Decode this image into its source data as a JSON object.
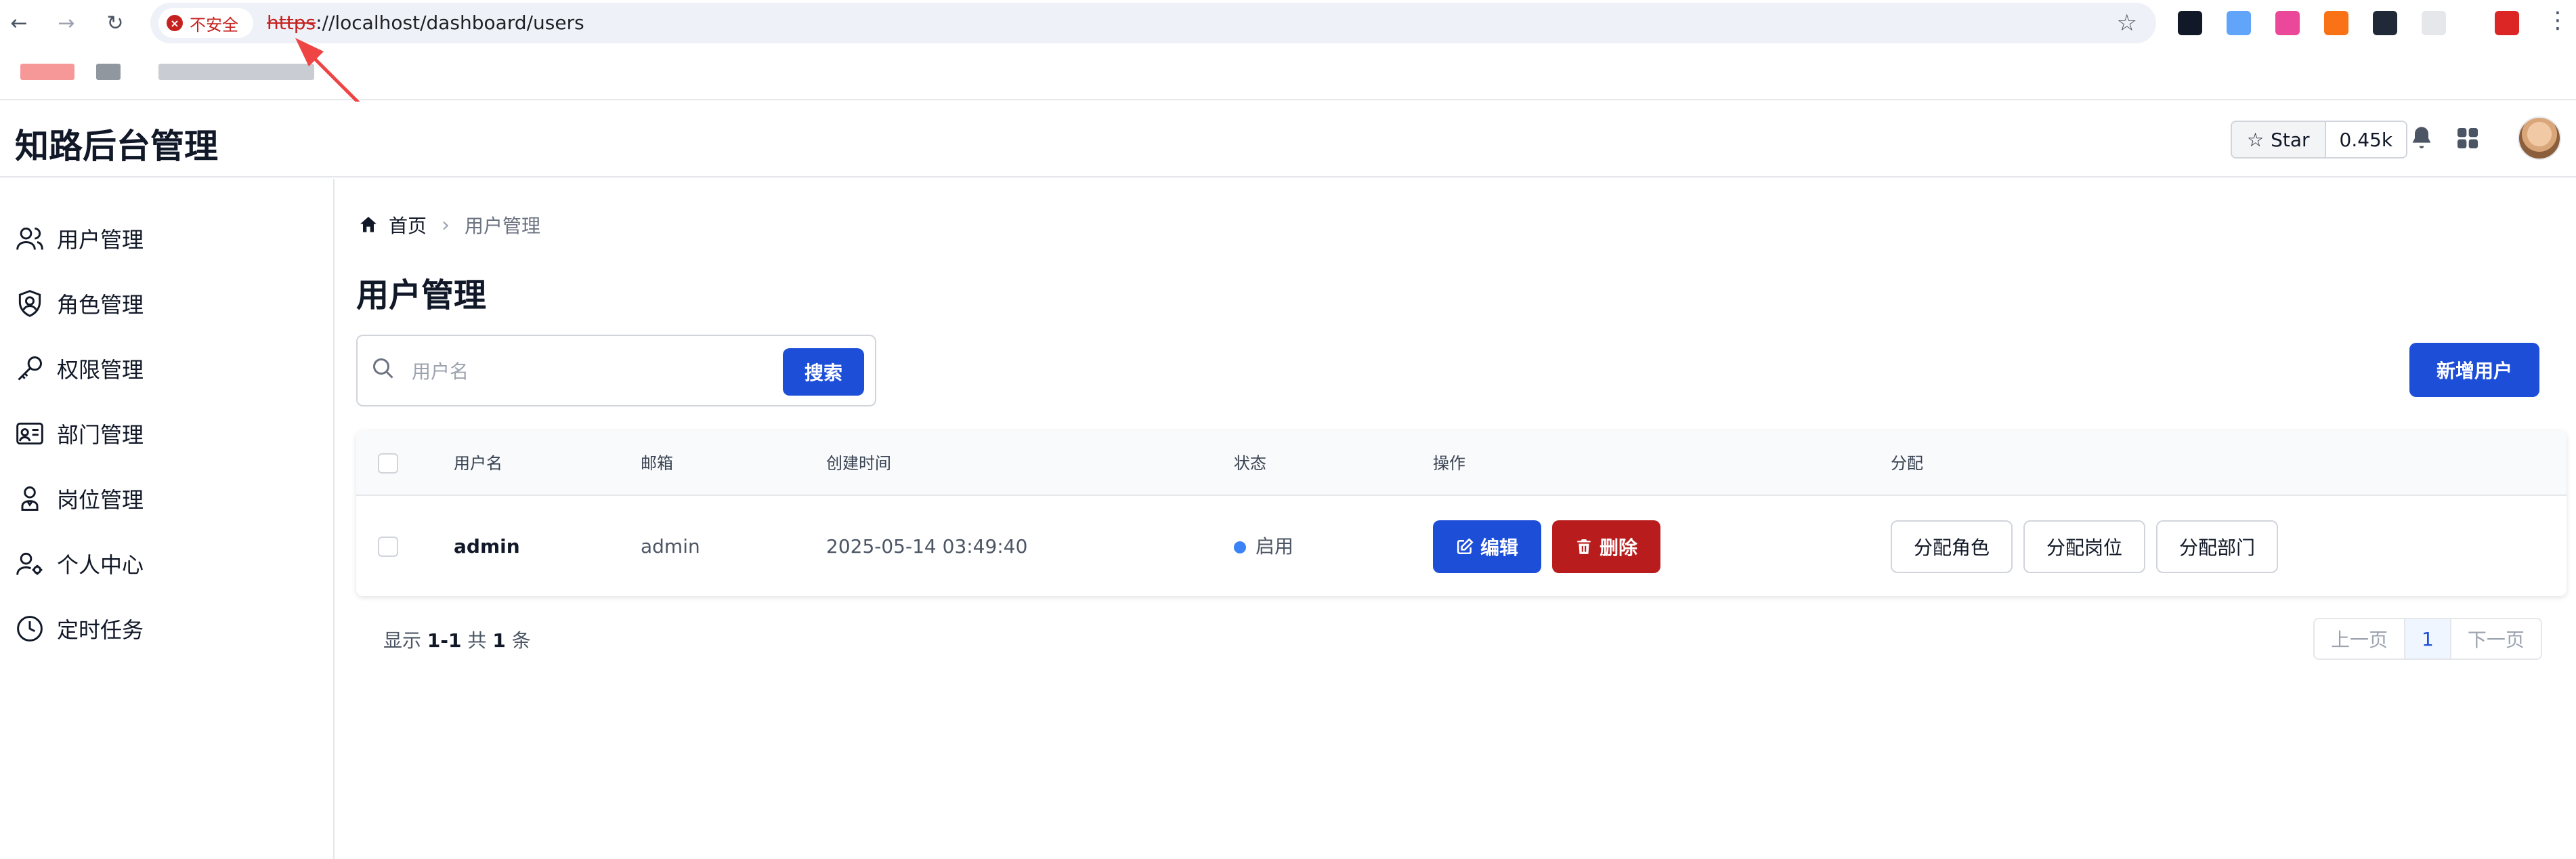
{
  "browser": {
    "security_label": "不安全",
    "url_scheme": "https",
    "url_rest": "://localhost/dashboard/users"
  },
  "app": {
    "brand": "知路后台管理",
    "star_label": "Star",
    "star_count": "0.45k"
  },
  "sidebar": {
    "items": [
      {
        "label": "用户管理",
        "icon": "users-icon"
      },
      {
        "label": "角色管理",
        "icon": "shield-user-icon"
      },
      {
        "label": "权限管理",
        "icon": "key-icon"
      },
      {
        "label": "部门管理",
        "icon": "department-icon"
      },
      {
        "label": "岗位管理",
        "icon": "badge-icon"
      },
      {
        "label": "个人中心",
        "icon": "user-cog-icon"
      },
      {
        "label": "定时任务",
        "icon": "clock-icon"
      }
    ]
  },
  "breadcrumb": {
    "home": "首页",
    "current": "用户管理"
  },
  "page": {
    "title": "用户管理"
  },
  "search": {
    "placeholder": "用户名",
    "button": "搜索"
  },
  "toolbar": {
    "new_user": "新增用户"
  },
  "table": {
    "headers": {
      "username": "用户名",
      "email": "邮箱",
      "created": "创建时间",
      "status": "状态",
      "actions": "操作",
      "assign": "分配"
    },
    "rows": [
      {
        "username": "admin",
        "email": "admin",
        "created": "2025-05-14 03:49:40",
        "status": "启用",
        "edit": "编辑",
        "delete": "删除",
        "assign_role": "分配角色",
        "assign_post": "分配岗位",
        "assign_dept": "分配部门"
      }
    ]
  },
  "footer": {
    "prefix": "显示",
    "range": "1-1",
    "total_prefix": "共",
    "total": "1",
    "suffix": "条"
  },
  "pagination": {
    "prev": "上一页",
    "current": "1",
    "next": "下一页"
  },
  "colors": {
    "primary": "#1d4ed8",
    "danger": "#b91c1c",
    "status_active": "#3b82f6",
    "annotation": "#ef4444"
  }
}
